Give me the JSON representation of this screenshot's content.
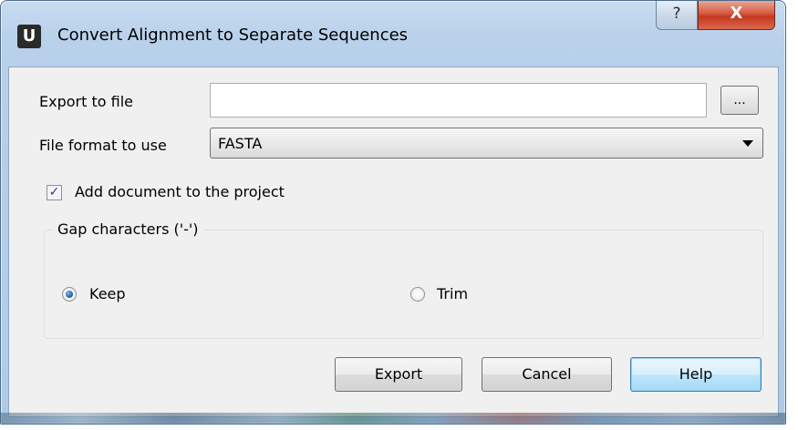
{
  "window": {
    "title": "Convert Alignment to Separate Sequences",
    "app_icon_letter": "U",
    "help_glyph": "?",
    "close_glyph": "X"
  },
  "export_file": {
    "label": "Export to file",
    "value": "",
    "browse_label": "..."
  },
  "file_format": {
    "label": "File format to use",
    "selected": "FASTA"
  },
  "add_to_project": {
    "label": "Add document to the project",
    "checked": true,
    "check_glyph": "✓"
  },
  "gap_characters": {
    "title": "Gap characters ('-')",
    "options": [
      {
        "label": "Keep",
        "selected": true
      },
      {
        "label": "Trim",
        "selected": false
      }
    ]
  },
  "buttons": {
    "export": "Export",
    "cancel": "Cancel",
    "help": "Help"
  },
  "colors": {
    "titlebar": "#b9d1ea",
    "close_button": "#c4381e",
    "dialog_background": "#f0f0f0",
    "default_button_border": "#3c7fb1"
  }
}
